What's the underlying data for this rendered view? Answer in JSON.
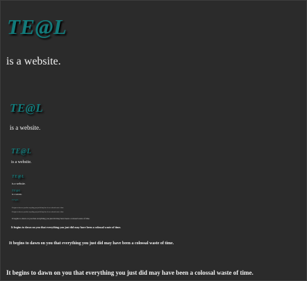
{
  "site": {
    "name": "TE@L",
    "tagline": "is a website."
  },
  "message": "It begins to dawn on you that everything you just did may have been a colossal waste of time.",
  "colors": {
    "background": "#2b2b2b",
    "logo": "#127a7a",
    "text": "#f2f2f2"
  }
}
